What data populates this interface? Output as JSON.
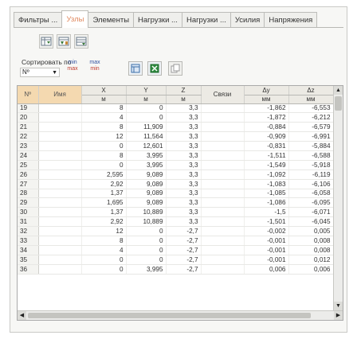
{
  "tabs": [
    {
      "label": "Фильтры ..."
    },
    {
      "label": "Узлы"
    },
    {
      "label": "Элементы"
    },
    {
      "label": "Нагрузки ..."
    },
    {
      "label": "Нагрузки ..."
    },
    {
      "label": "Усилия"
    },
    {
      "label": "Напряжения"
    }
  ],
  "active_tab": 1,
  "sort": {
    "label": "Сортировать по",
    "selected": "Nº",
    "asc_lines": [
      "min",
      "max"
    ],
    "desc_lines": [
      "max",
      "min"
    ]
  },
  "icons": {
    "toolbar": [
      "filter-table-icon",
      "filter-columns-icon",
      "filter-rows-icon"
    ],
    "actions": [
      "table-view-icon",
      "excel-export-icon",
      "copy-icon"
    ]
  },
  "columns": [
    {
      "label": "Nº",
      "unit": ""
    },
    {
      "label": "Имя",
      "unit": ""
    },
    {
      "label": "X",
      "unit": "м"
    },
    {
      "label": "Y",
      "unit": "м"
    },
    {
      "label": "Z",
      "unit": "м"
    },
    {
      "label": "Связи",
      "unit": ""
    },
    {
      "label": "Δy",
      "unit": "мм"
    },
    {
      "label": "Δz",
      "unit": "мм"
    }
  ],
  "rows": [
    [
      "19",
      "",
      "8",
      "0",
      "3,3",
      "",
      "-1,862",
      "-6,553"
    ],
    [
      "20",
      "",
      "4",
      "0",
      "3,3",
      "",
      "-1,872",
      "-6,212"
    ],
    [
      "21",
      "",
      "8",
      "11,909",
      "3,3",
      "",
      "-0,884",
      "-6,579"
    ],
    [
      "22",
      "",
      "12",
      "11,564",
      "3,3",
      "",
      "-0,909",
      "-6,991"
    ],
    [
      "23",
      "",
      "0",
      "12,601",
      "3,3",
      "",
      "-0,831",
      "-5,884"
    ],
    [
      "24",
      "",
      "8",
      "3,995",
      "3,3",
      "",
      "-1,511",
      "-6,588"
    ],
    [
      "25",
      "",
      "0",
      "3,995",
      "3,3",
      "",
      "-1,549",
      "-5,918"
    ],
    [
      "26",
      "",
      "2,595",
      "9,089",
      "3,3",
      "",
      "-1,092",
      "-6,119"
    ],
    [
      "27",
      "",
      "2,92",
      "9,089",
      "3,3",
      "",
      "-1,083",
      "-6,106"
    ],
    [
      "28",
      "",
      "1,37",
      "9,089",
      "3,3",
      "",
      "-1,085",
      "-6,058"
    ],
    [
      "29",
      "",
      "1,695",
      "9,089",
      "3,3",
      "",
      "-1,086",
      "-6,095"
    ],
    [
      "30",
      "",
      "1,37",
      "10,889",
      "3,3",
      "",
      "-1,5",
      "-6,071"
    ],
    [
      "31",
      "",
      "2,92",
      "10,889",
      "3,3",
      "",
      "-1,501",
      "-6,045"
    ],
    [
      "32",
      "",
      "12",
      "0",
      "-2,7",
      "",
      "-0,002",
      "0,005"
    ],
    [
      "33",
      "",
      "8",
      "0",
      "-2,7",
      "",
      "-0,001",
      "0,008"
    ],
    [
      "34",
      "",
      "4",
      "0",
      "-2,7",
      "",
      "-0,001",
      "0,008"
    ],
    [
      "35",
      "",
      "0",
      "0",
      "-2,7",
      "",
      "-0,001",
      "0,012"
    ],
    [
      "36",
      "",
      "0",
      "3,995",
      "-2,7",
      "",
      "0,006",
      "0,006"
    ]
  ]
}
